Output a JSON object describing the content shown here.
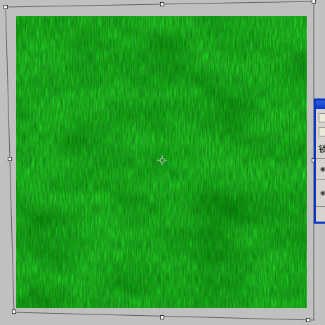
{
  "document": {
    "content": "grass-texture",
    "colors": {
      "background": "#c0c0c0",
      "grass_base": "#0f7a12",
      "grass_dark": "#0a5a0c",
      "grass_light": "#22a524",
      "panel_frame": "#0a36c8"
    }
  },
  "transform": {
    "handles": [
      "top-left",
      "top-center",
      "top-right",
      "middle-left",
      "middle-right",
      "bottom-left",
      "bottom-center",
      "bottom-right"
    ],
    "center_icon": "crosshair-icon"
  },
  "side_panel": {
    "label_fragment": "锁",
    "icons": [
      "eye-icon",
      "eye-icon"
    ]
  }
}
